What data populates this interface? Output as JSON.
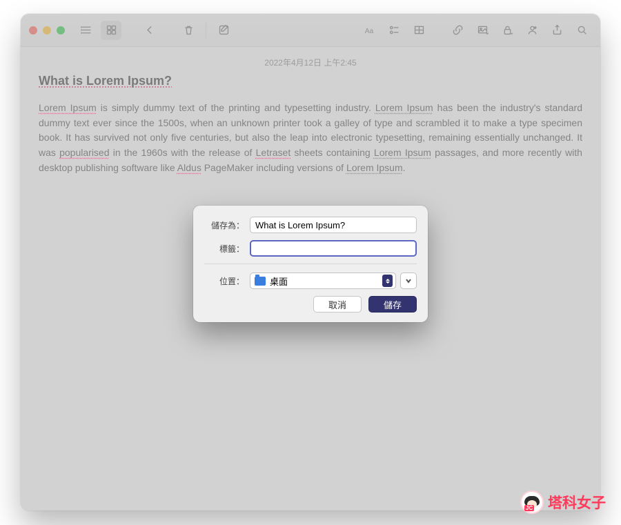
{
  "note": {
    "timestamp": "2022年4月12日 上午2:45",
    "title": "What is Lorem Ipsum?",
    "body_html": "<span class='sq'>Lorem Ipsum</span> is simply dummy text of the printing and typesetting industry. <span class='sq'>Lorem Ipsum</span> has been the industry's standard dummy text ever since the 1500s, when an unknown printer took a galley of type and scrambled it to make a type specimen book. It has survived not only five centuries, but also the leap into electronic typesetting, remaining essentially unchanged. It was <span class='sq'>popularised</span> in the 1960s with the release of <span class='sq'>Letraset</span> sheets containing <span class='sq'>Lorem Ipsum</span> passages, and more recently with desktop publishing software like <span class='sq'>Aldus</span> PageMaker including versions of <span class='sq'>Lorem Ipsum</span>."
  },
  "save_sheet": {
    "save_as_label": "儲存為：",
    "save_as_value": "What is Lorem Ipsum?",
    "tags_label": "標籤：",
    "tags_value": "",
    "location_label": "位置：",
    "location_value": "桌面",
    "cancel": "取消",
    "save": "儲存"
  },
  "watermark": {
    "text": "塔科女子",
    "badge": "JC"
  }
}
